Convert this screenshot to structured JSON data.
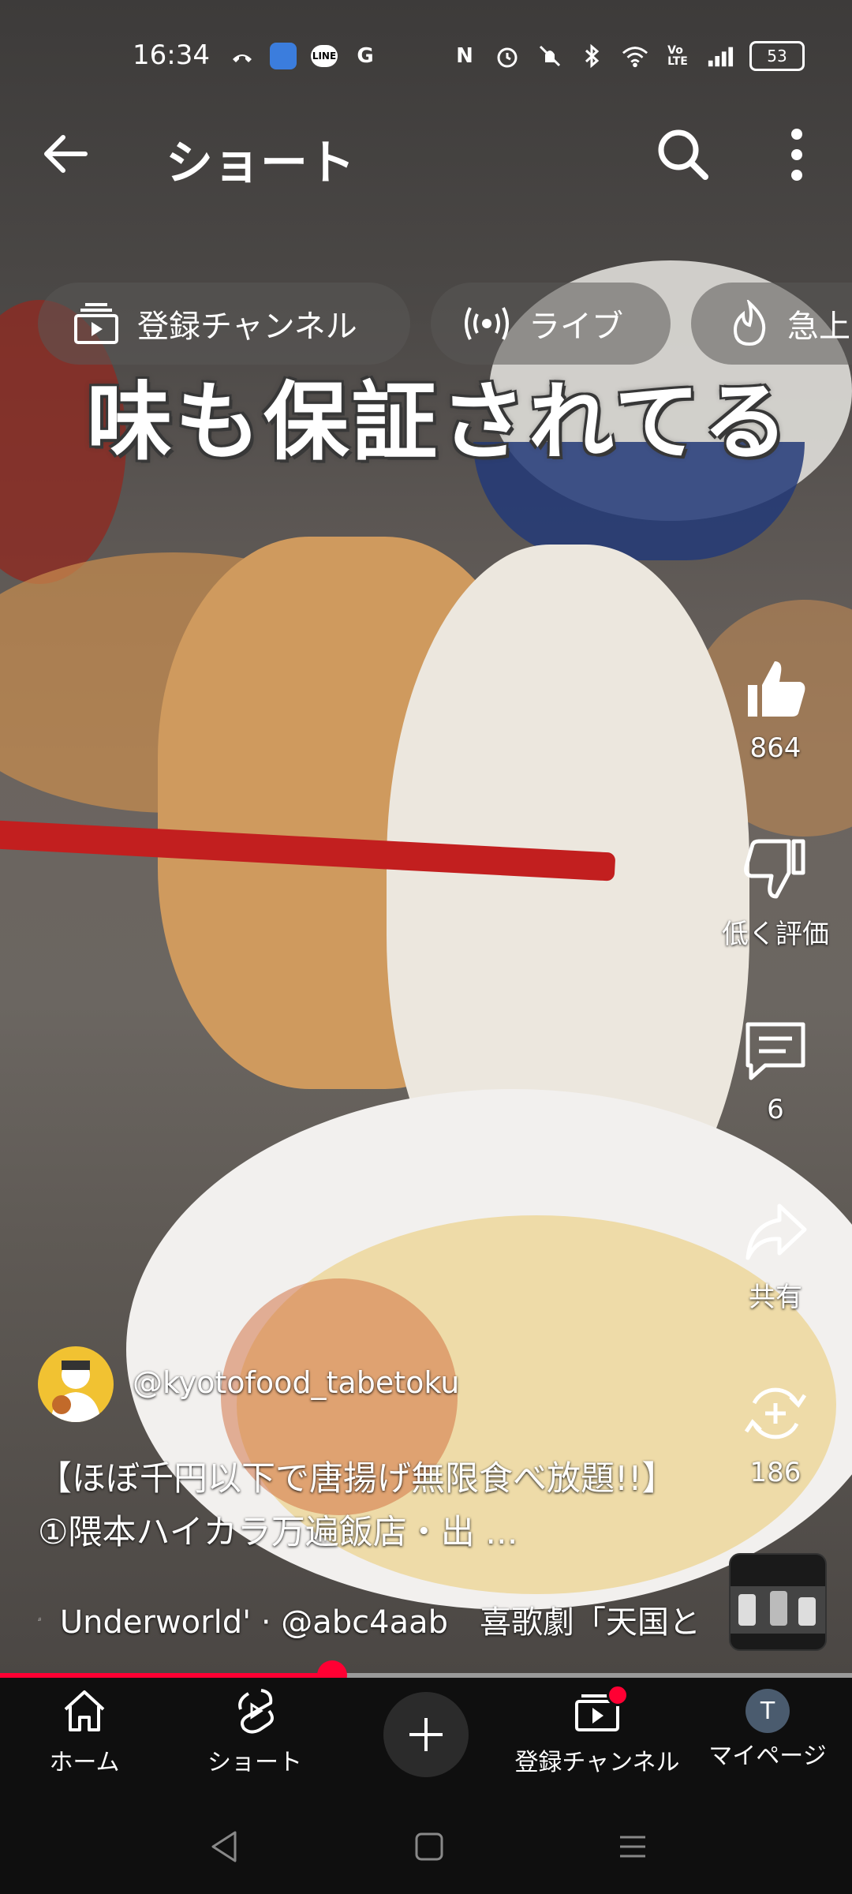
{
  "status": {
    "time": "16:34",
    "battery": "53",
    "left_icons": [
      "missed-call-icon",
      "app-icon",
      "line-icon",
      "google-icon"
    ],
    "right_icons": [
      "nfc-icon",
      "alarm-icon",
      "mute-icon",
      "bluetooth-icon",
      "wifi-icon",
      "volte-icon",
      "signal-icon"
    ]
  },
  "header": {
    "title": "ショート"
  },
  "chips": [
    {
      "label": "登録チャンネル",
      "icon": "subscriptions-icon"
    },
    {
      "label": "ライブ",
      "icon": "live-icon"
    },
    {
      "label": "急上",
      "icon": "trending-icon"
    }
  ],
  "video": {
    "overlay_text": "味も保証されてる"
  },
  "actions": {
    "like_count": "864",
    "dislike_label": "低く評価",
    "comment_count": "6",
    "share_label": "共有",
    "remix_count": "186"
  },
  "channel": {
    "handle": "@kyotofood_tabetoku"
  },
  "description": "【ほぼ千円以下で唐揚げ無限食べ放題!!】①隈本ハイカラ万遍飯店・出 ...",
  "music": {
    "text": "Underworld' · @abc4aab　喜歌劇「天国と"
  },
  "progress": {
    "fraction": 0.39
  },
  "nav": {
    "home": "ホーム",
    "shorts": "ショート",
    "subscriptions": "登録チャンネル",
    "mypage": "マイページ",
    "avatar_letter": "T"
  },
  "colors": {
    "accent": "#ff0033",
    "nav_bg": "#0f0f0f"
  }
}
